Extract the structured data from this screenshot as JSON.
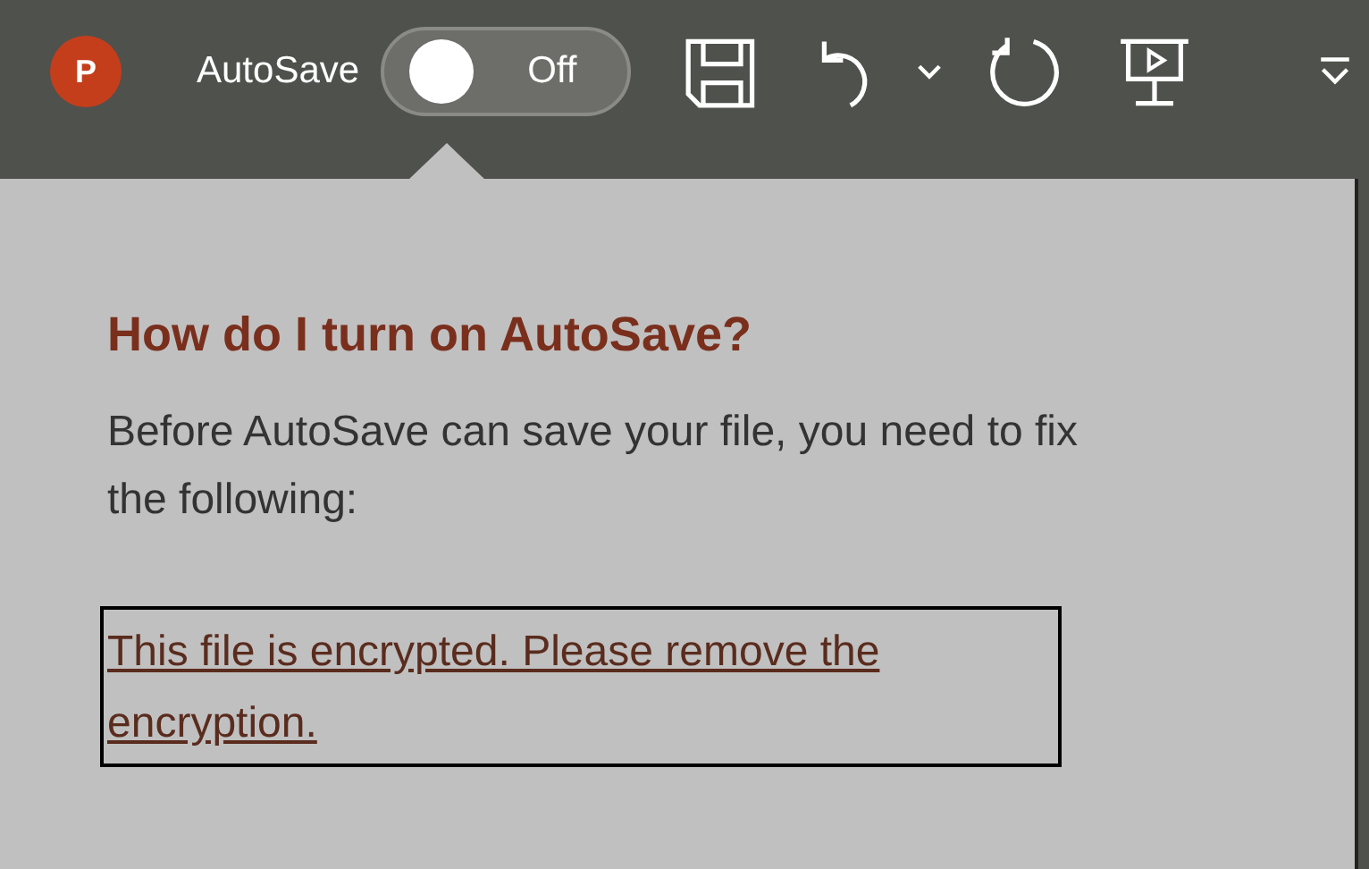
{
  "app_logo": {
    "letter": "P"
  },
  "autosave": {
    "label": "AutoSave",
    "on": false,
    "state_text": "Off"
  },
  "callout": {
    "title": "How do I turn on AutoSave?",
    "body": "Before AutoSave can save your file, you need to fix the following:",
    "link": "This file is encrypted. Please remove the encryption.",
    "link_focused": true
  }
}
